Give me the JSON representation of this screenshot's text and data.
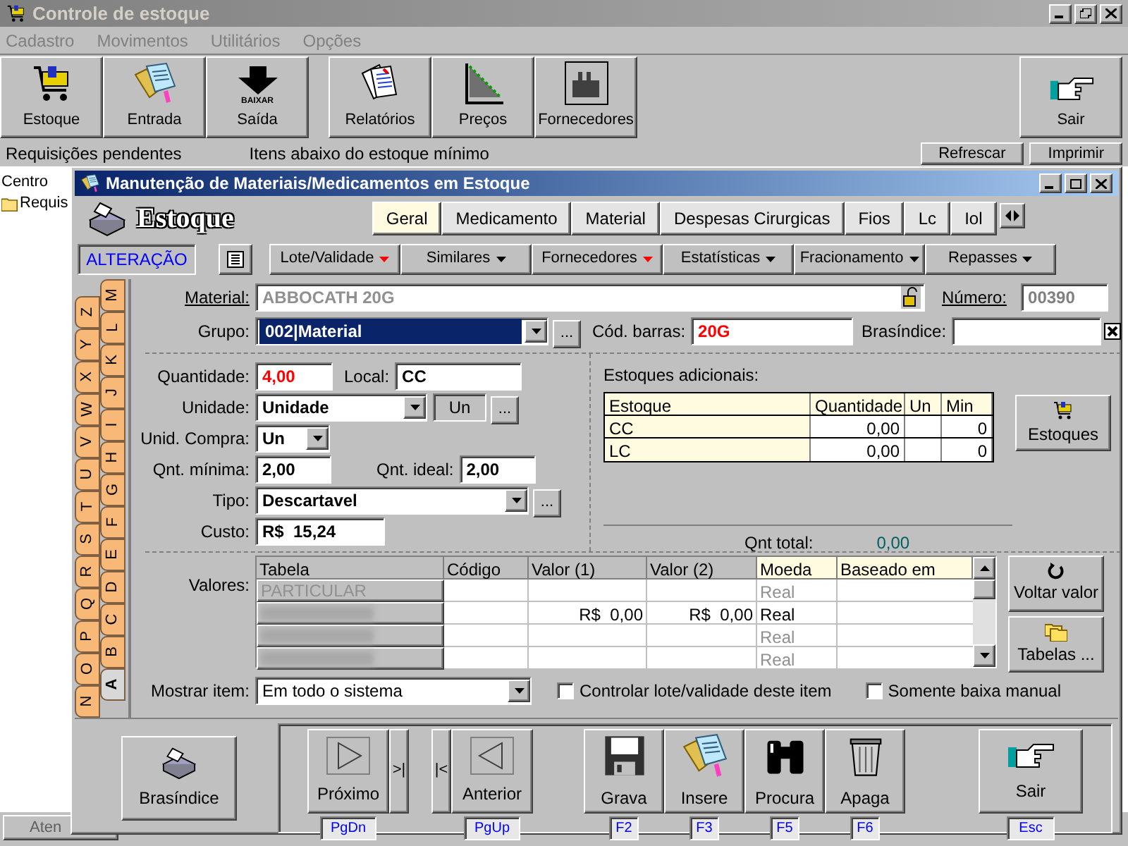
{
  "app": {
    "title": "Controle de estoque",
    "menu": [
      {
        "label": "Cadastro"
      },
      {
        "label": "Movimentos"
      },
      {
        "label": "Utilitários"
      },
      {
        "label": "Opções"
      }
    ],
    "toolbar": [
      {
        "label": "Estoque",
        "kind": "cart"
      },
      {
        "label": "Entrada",
        "kind": "entry"
      },
      {
        "label": "Saída",
        "kind": "exit",
        "icon_caption": "BAIXAR"
      },
      {
        "label": "Relatórios",
        "kind": "reports"
      },
      {
        "label": "Preços",
        "kind": "prices"
      },
      {
        "label": "Fornecedores",
        "kind": "factory"
      },
      {
        "label": "Sair",
        "kind": "quit"
      }
    ],
    "strip": {
      "left_label": "Requisições pendentes",
      "right_label": "Itens abaixo do estoque mínimo",
      "buttons": [
        "Refrescar",
        "Imprimir"
      ]
    },
    "tree": [
      {
        "label": "Centro",
        "kind": "plain"
      },
      {
        "label": "Requis",
        "kind": "folder"
      }
    ],
    "bottom_tab": "Aten"
  },
  "dialog": {
    "title": "Manutenção de Materiais/Medicamentos em Estoque",
    "heading": "Estoque",
    "tabs": [
      {
        "label": "Geral",
        "selected": true
      },
      {
        "label": "Medicamento",
        "selected": false
      },
      {
        "label": "Material",
        "selected": false
      },
      {
        "label": "Despesas Cirurgicas",
        "selected": false
      },
      {
        "label": "Fios",
        "selected": false
      },
      {
        "label": "Lc",
        "selected": false
      },
      {
        "label": "Iol",
        "selected": false
      }
    ],
    "mode": "ALTERAÇÃO",
    "menus": [
      {
        "label": "Lote/Validade",
        "color": "#ff0000"
      },
      {
        "label": "Similares",
        "color": "#000000"
      },
      {
        "label": "Fornecedores",
        "color": "#ff0000"
      },
      {
        "label": "Estatísticas",
        "color": "#000000"
      },
      {
        "label": "Fracionamento",
        "color": "#000000"
      },
      {
        "label": "Repasses",
        "color": "#000000"
      }
    ],
    "letters_outer": [
      {
        "label": "Z",
        "selected": false
      },
      {
        "label": "Y",
        "selected": false
      },
      {
        "label": "X",
        "selected": false
      },
      {
        "label": "W",
        "selected": false
      },
      {
        "label": "V",
        "selected": false
      },
      {
        "label": "U",
        "selected": false
      },
      {
        "label": "T",
        "selected": false
      },
      {
        "label": "S",
        "selected": false
      },
      {
        "label": "R",
        "selected": false
      },
      {
        "label": "Q",
        "selected": false
      },
      {
        "label": "P",
        "selected": false
      },
      {
        "label": "O",
        "selected": false
      },
      {
        "label": "N",
        "selected": false
      }
    ],
    "letters_inner": [
      {
        "label": "M",
        "selected": false
      },
      {
        "label": "L",
        "selected": false
      },
      {
        "label": "K",
        "selected": false
      },
      {
        "label": "J",
        "selected": false
      },
      {
        "label": "I",
        "selected": false
      },
      {
        "label": "H",
        "selected": false
      },
      {
        "label": "G",
        "selected": false
      },
      {
        "label": "F",
        "selected": false
      },
      {
        "label": "E",
        "selected": false
      },
      {
        "label": "D",
        "selected": false
      },
      {
        "label": "C",
        "selected": false
      },
      {
        "label": "B",
        "selected": false
      },
      {
        "label": "A",
        "selected": true
      }
    ],
    "material": {
      "label": "Material:",
      "value": "ABBOCATH 20G",
      "disabled": true
    },
    "numero": {
      "label": "Número:",
      "value": "00390",
      "disabled": true
    },
    "grupo": {
      "label": "Grupo:",
      "value": "002|Material",
      "more": "..."
    },
    "cod_barras": {
      "label": "Cód. barras:",
      "value": "20G"
    },
    "brasindice": {
      "label": "Brasíndice:"
    },
    "quantidade": {
      "label": "Quantidade:",
      "value": "4,00"
    },
    "local": {
      "label": "Local:",
      "value": "CC"
    },
    "unidade": {
      "label": "Unidade:",
      "value": "Unidade",
      "abbrev": "Un",
      "more": "..."
    },
    "unid_compra": {
      "label": "Unid. Compra:",
      "value": "Un"
    },
    "qnt_minima": {
      "label": "Qnt. mínima:",
      "value": "2,00"
    },
    "qnt_ideal": {
      "label": "Qnt. ideal:",
      "value": "2,00"
    },
    "tipo": {
      "label": "Tipo:",
      "value": "Descartavel",
      "more": "..."
    },
    "custo": {
      "label": "Custo:",
      "value": "R$  15,24"
    },
    "estoques_adicionais": {
      "title": "Estoques adicionais:",
      "columns": [
        "Estoque",
        "Quantidade",
        "Un",
        "Min"
      ],
      "rows": [
        [
          "CC",
          "0,00",
          "",
          "0"
        ],
        [
          "LC",
          "0,00",
          "",
          "0"
        ]
      ],
      "total_label": "Qnt total:",
      "total": "0,00",
      "button": "Estoques"
    },
    "valores": {
      "label": "Valores:",
      "columns": [
        "Tabela",
        "Código",
        "Valor (1)",
        "Valor (2)",
        "Moeda",
        "Baseado em"
      ],
      "rows": [
        {
          "tabela": "PARTICULAR",
          "valor1": "",
          "valor2": "",
          "moeda": "Real",
          "dimmed": true
        },
        {
          "tabela": "",
          "valor1": "R$  0,00",
          "valor2": "R$  0,00",
          "moeda": "Real",
          "dimmed": false
        },
        {
          "tabela": "",
          "valor1": "",
          "valor2": "",
          "moeda": "Real",
          "dimmed": true
        },
        {
          "tabela": "",
          "valor1": "",
          "valor2": "",
          "moeda": "Real",
          "dimmed": true
        }
      ],
      "buttons": [
        "Voltar valor",
        "Tabelas ..."
      ]
    },
    "mostrar": {
      "label": "Mostrar item:",
      "value": "Em todo o sistema"
    },
    "checkboxes": [
      {
        "label": "Controlar lote/validade deste item",
        "checked": false
      },
      {
        "label": "Somente baixa manual",
        "checked": false
      }
    ],
    "brasindice_button": "Brasíndice",
    "nav": [
      {
        "label": "Próximo",
        "key": "PgDn",
        "kind": "next",
        "jump": ">|"
      },
      {
        "label": "Anterior",
        "key": "PgUp",
        "kind": "prev",
        "jump": "|<"
      }
    ],
    "actions": [
      {
        "label": "Grava",
        "key": "F2",
        "kind": "disk"
      },
      {
        "label": "Insere",
        "key": "F3",
        "kind": "entry"
      },
      {
        "label": "Procura",
        "key": "F5",
        "kind": "binoculars"
      },
      {
        "label": "Apaga",
        "key": "F6",
        "kind": "trash"
      }
    ],
    "quit": {
      "label": "Sair",
      "key": "Esc"
    }
  }
}
